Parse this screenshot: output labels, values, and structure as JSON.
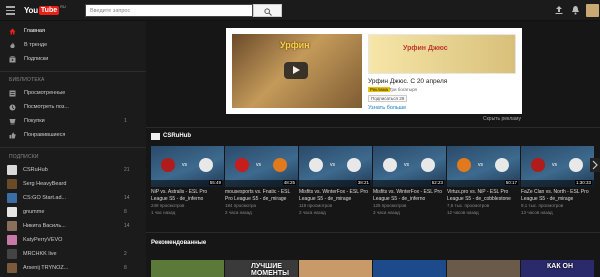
{
  "header": {
    "logo_you": "You",
    "logo_tube": "Tube",
    "logo_region": "RU",
    "search_placeholder": "Введите запрос"
  },
  "sidebar": {
    "nav": [
      {
        "label": "Главная",
        "icon": "home-icon",
        "active": true
      },
      {
        "label": "В тренде",
        "icon": "trending-icon",
        "active": false
      },
      {
        "label": "Подписки",
        "icon": "subscriptions-icon",
        "active": false
      }
    ],
    "library_header": "БИБЛИОТЕКА",
    "library": [
      {
        "label": "Просмотренные",
        "icon": "history-icon"
      },
      {
        "label": "Посмотреть поз...",
        "icon": "watch-later-icon"
      },
      {
        "label": "Покупки",
        "icon": "purchases-icon",
        "count": "1"
      },
      {
        "label": "Понравившиеся",
        "icon": "like-icon"
      }
    ],
    "subs_header": "ПОДПИСКИ",
    "subscriptions": [
      {
        "label": "CSRuHub",
        "count": "21",
        "color": "#d9d9d9"
      },
      {
        "label": "Serg HeavyBeard",
        "count": "",
        "color": "#6b4a2a"
      },
      {
        "label": "CS:GO Start.ad...",
        "count": "14",
        "color": "#3a6ea5"
      },
      {
        "label": "gnumme",
        "count": "8",
        "color": "#e5e5e5"
      },
      {
        "label": "Никита Василь...",
        "count": "14",
        "color": "#8a6f5a"
      },
      {
        "label": "KatyPerryVEVO",
        "count": "",
        "color": "#c77aa8"
      },
      {
        "label": "MRCHKK live",
        "count": "2",
        "color": "#444"
      },
      {
        "label": "Arsenij TRYNOZ...",
        "count": "8",
        "color": "#7a5a3a"
      }
    ]
  },
  "ad": {
    "video_title": "Урфин",
    "banner_title": "Урфин Джюс",
    "title": "Урфин Джюс. С 20 апреля",
    "badge": "Реклама",
    "channel": "Три богатыря",
    "subscribe": "Подписаться",
    "subscribe_count": "29",
    "more": "Узнать больше",
    "hide": "Скрыть рекламу"
  },
  "channel_section": {
    "title": "CSRuHub",
    "videos": [
      {
        "title": "NiP vs. Astralis - ESL Pro League S5 - de_inferno",
        "views": "249 просмотров",
        "ago": "1 час назад",
        "duration": "55:49",
        "left_color": "#b01b1b",
        "right_color": "#e8e8e8"
      },
      {
        "title": "mousesports vs. Fnatic - ESL Pro League S5 - de_mirage",
        "views": "184 просмотра",
        "ago": "2 часа назад",
        "duration": "48:25",
        "left_color": "#c81d1d",
        "right_color": "#e07a1d"
      },
      {
        "title": "Misfits vs. WinterFox - ESL Pro League S5 - de_mirage",
        "views": "119 просмотров",
        "ago": "2 часа назад",
        "duration": "38:21",
        "left_color": "#e8e8e8",
        "right_color": "#e8e8e8"
      },
      {
        "title": "Misfits vs. WinterFox - ESL Pro League S5 - de_inferno",
        "views": "125 просмотров",
        "ago": "3 часа назад",
        "duration": "52:23",
        "left_color": "#e8e8e8",
        "right_color": "#e8e8e8"
      },
      {
        "title": "Virtus.pro vs. NiP - ESL Pro League S5 - de_cobblestone",
        "views": "7,6 тыс. просмотров",
        "ago": "12 часов назад",
        "duration": "50:17",
        "left_color": "#e07a1d",
        "right_color": "#e8e8e8"
      },
      {
        "title": "FaZe Clan vs. North - ESL Pro League S5 - de_mirage",
        "views": "9,1 тыс. просмотров",
        "ago": "13 часов назад",
        "duration": "1:30:33",
        "left_color": "#b01b1b",
        "right_color": "#e8e8e8"
      }
    ],
    "vs_label": "vs"
  },
  "recommended": {
    "title": "Рекомендованные",
    "thumbs": [
      {
        "text": "",
        "color": "#5b7a3a"
      },
      {
        "text": "ЛУЧШИЕ МОМЕНТЫ",
        "color": "#3a3a3a"
      },
      {
        "text": "",
        "color": "#c89a6a"
      },
      {
        "text": "",
        "color": "#1d4a8a"
      },
      {
        "text": "",
        "color": "#6a5a4a"
      },
      {
        "text": "КАК ОН",
        "color": "#2a2a6a"
      }
    ]
  },
  "colors": {
    "accent": "#e62117",
    "link": "#167ac6",
    "background": "#161616",
    "sidebar": "#1b1b1b"
  }
}
